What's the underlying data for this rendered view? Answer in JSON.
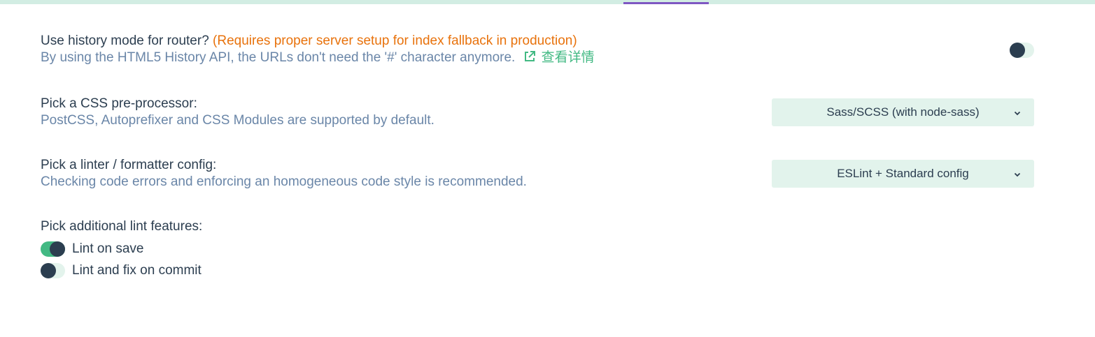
{
  "history": {
    "label": "Use history mode for router?",
    "warning": "(Requires proper server setup for index fallback in production)",
    "description": "By using the HTML5 History API, the URLs don't need the '#' character anymore.",
    "more_label": "查看详情",
    "enabled": false
  },
  "css": {
    "label": "Pick a CSS pre-processor:",
    "description": "PostCSS, Autoprefixer and CSS Modules are supported by default.",
    "selected": "Sass/SCSS (with node-sass)"
  },
  "linter": {
    "label": "Pick a linter / formatter config:",
    "description": "Checking code errors and enforcing an homogeneous code style is recommended.",
    "selected": "ESLint + Standard config"
  },
  "lint_features": {
    "label": "Pick additional lint features:",
    "options": [
      {
        "label": "Lint on save",
        "enabled": true
      },
      {
        "label": "Lint and fix on commit",
        "enabled": false
      }
    ]
  },
  "colors": {
    "accent": "#42b983",
    "warning": "#e8720c",
    "text": "#2c3e50",
    "muted": "#6a86a8",
    "tab_indicator": "#7e57c2"
  },
  "icons": {
    "external": "external-link-icon",
    "chevron": "chevron-down-icon"
  }
}
